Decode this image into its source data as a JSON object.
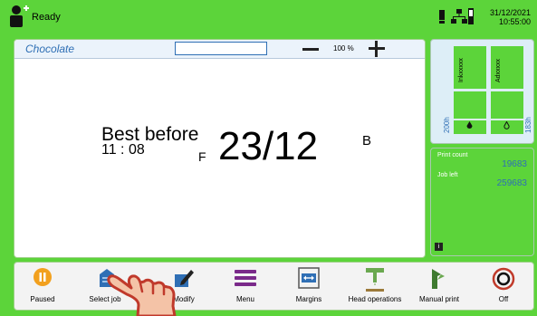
{
  "header": {
    "status": "Ready",
    "date": "31/12/2021",
    "time": "10:55:00",
    "icons": [
      "operator-icon",
      "alarm-icon",
      "network-icon",
      "consumable-icon"
    ]
  },
  "editor": {
    "job_name": "Chocolate",
    "field_value": "",
    "zoom": "100 %",
    "message": {
      "line1": "Best before",
      "line2": "11 : 08",
      "f_marker": "F",
      "date_text": "23/12",
      "b_marker": "B"
    }
  },
  "consumables": {
    "ink_label": "Inkxxxxx",
    "additive_label": "Adxxxxx",
    "ink_hours": "200h",
    "additive_hours": "183h",
    "ink_level": 1.0,
    "additive_level": 1.0
  },
  "counters": {
    "print_count_label": "Print count",
    "print_count": "19683",
    "job_left_label": "Job left",
    "job_left": "259683"
  },
  "toolbar": {
    "paused": "Paused",
    "select_job": "Select job",
    "modify": "Modify",
    "menu": "Menu",
    "margins": "Margins",
    "head_operations": "Head operations",
    "manual_print": "Manual print",
    "off": "Off"
  },
  "colors": {
    "background": "#5cd43a",
    "accent_blue": "#2f6fb5",
    "pause_orange": "#f2a01e",
    "menu_purple": "#7a2a8a",
    "off_red": "#c03a2a"
  }
}
